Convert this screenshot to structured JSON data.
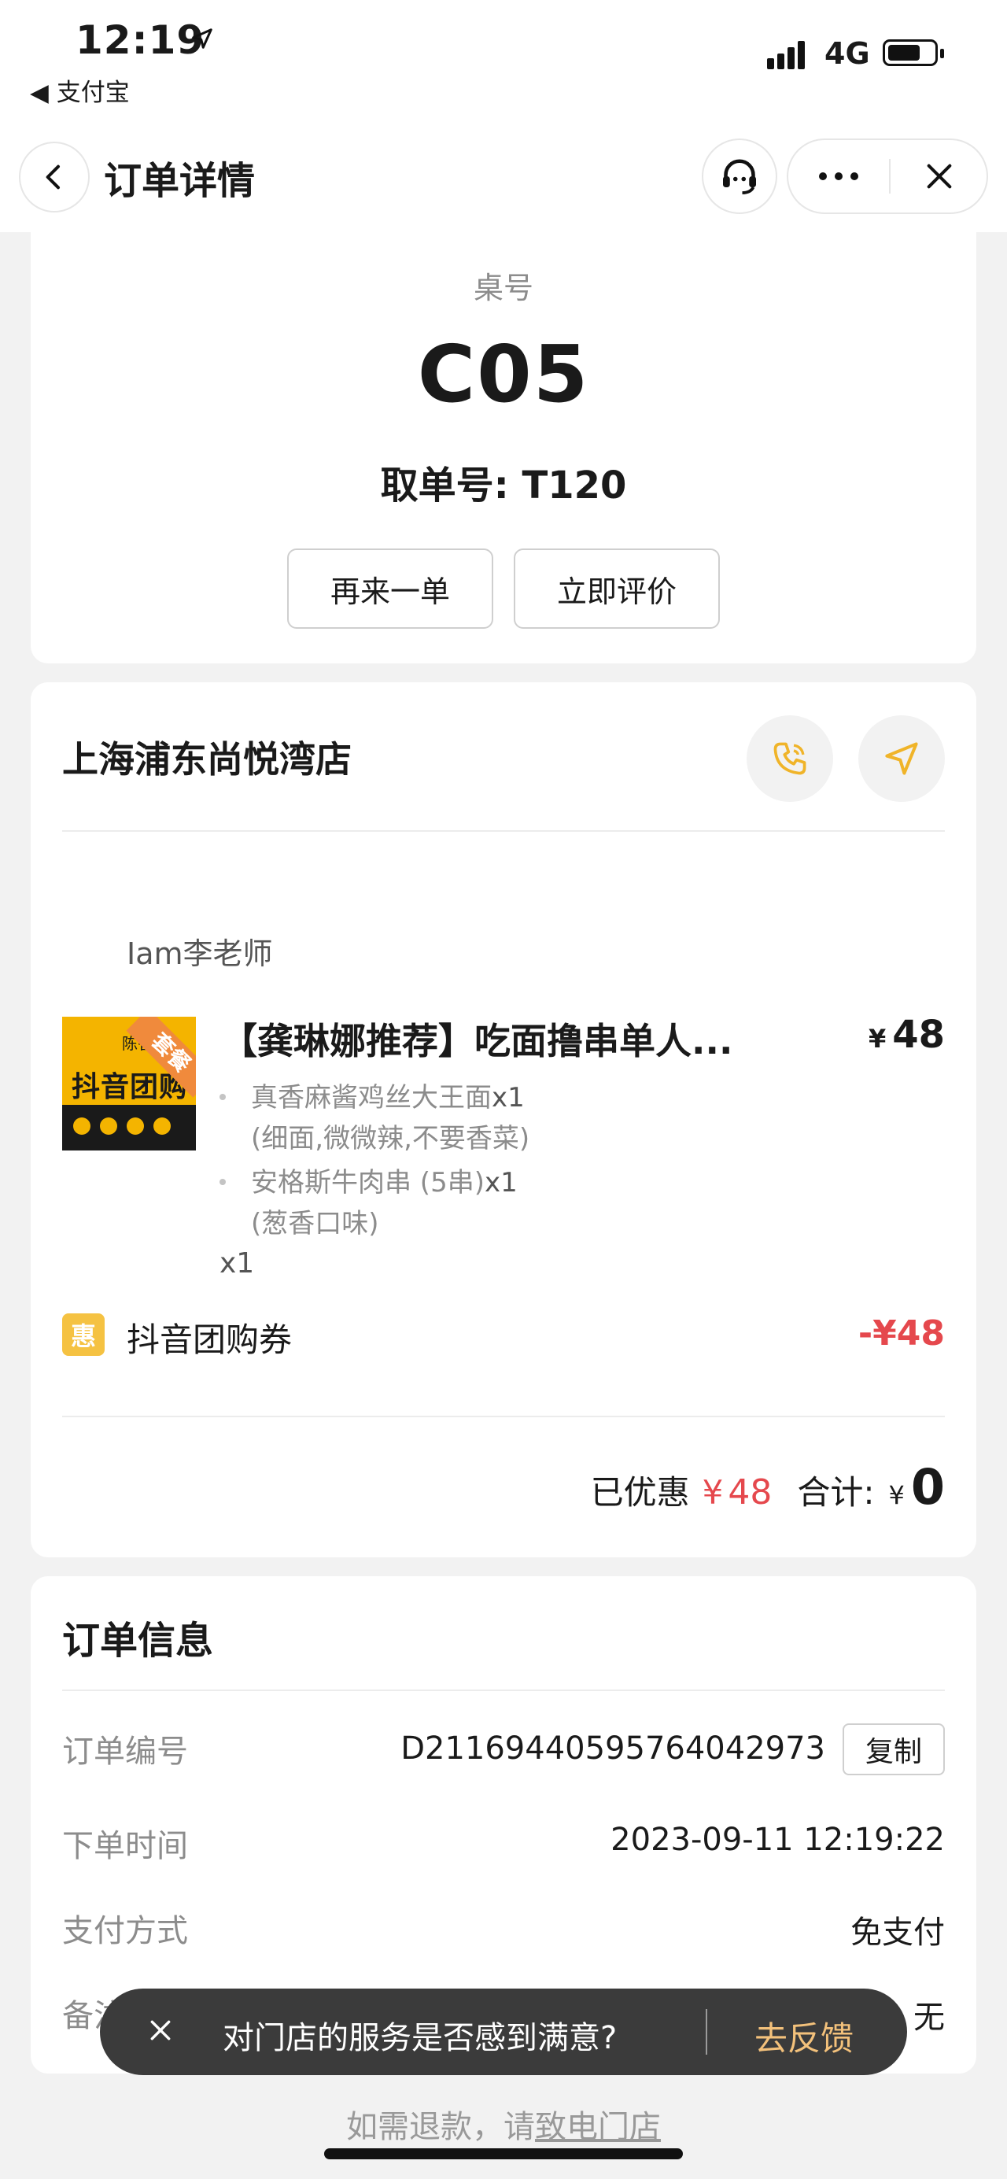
{
  "status_bar": {
    "time": "12:19",
    "back_app": "◀ 支付宝",
    "network": "4G"
  },
  "nav": {
    "title": "订单详情",
    "icons": [
      "back-icon",
      "customer-service-icon",
      "more-icon",
      "close-icon"
    ]
  },
  "table": {
    "label": "桌号",
    "number": "C05",
    "pickup_label": "取单号:",
    "pickup_number": "T120",
    "btn_reorder": "再来一单",
    "btn_review": "立即评价"
  },
  "store": {
    "name": "上海浦东尚悦湾店",
    "customer": "Iam李老师",
    "item": {
      "name": "【龚琳娜推荐】吃面撸串单人...",
      "price_symbol": "¥",
      "price": "48",
      "thumb_small": "陈香",
      "thumb_ribbon": "套餐",
      "thumb_brand": "抖音团购",
      "sub_items": [
        {
          "name": "真香麻酱鸡丝大王面",
          "qty": "x1",
          "note": "(细面,微微辣,不要香菜)"
        },
        {
          "name": "安格斯牛肉串 (5串)",
          "qty": "x1",
          "note": "(葱香口味)"
        }
      ],
      "qty": "x1"
    },
    "coupon": {
      "badge": "惠",
      "label": "抖音团购券",
      "amount": "-¥48"
    },
    "summary": {
      "discount_label": "已优惠",
      "discount_symbol": "¥",
      "discount_value": "48",
      "total_label": "合计:",
      "total_symbol": "¥",
      "total_value": "0"
    }
  },
  "order_info": {
    "title": "订单信息",
    "rows": [
      {
        "label": "订单编号",
        "value": "D21169440595764042973"
      },
      {
        "label": "下单时间",
        "value": "2023-09-11 12:19:22"
      },
      {
        "label": "支付方式",
        "value": "免支付"
      },
      {
        "label": "备注信息",
        "value": "无"
      }
    ],
    "copy_label": "复制"
  },
  "feedback": {
    "message": "对门店的服务是否感到满意?",
    "action": "去反馈"
  },
  "refund": {
    "prefix": "如需退款，请",
    "link": "致电门店"
  },
  "colors": {
    "accent_red": "#e5484d",
    "coupon_yellow": "#f5c242",
    "icon_gold": "#f0b429",
    "feedback_gold": "#f3c17b"
  }
}
